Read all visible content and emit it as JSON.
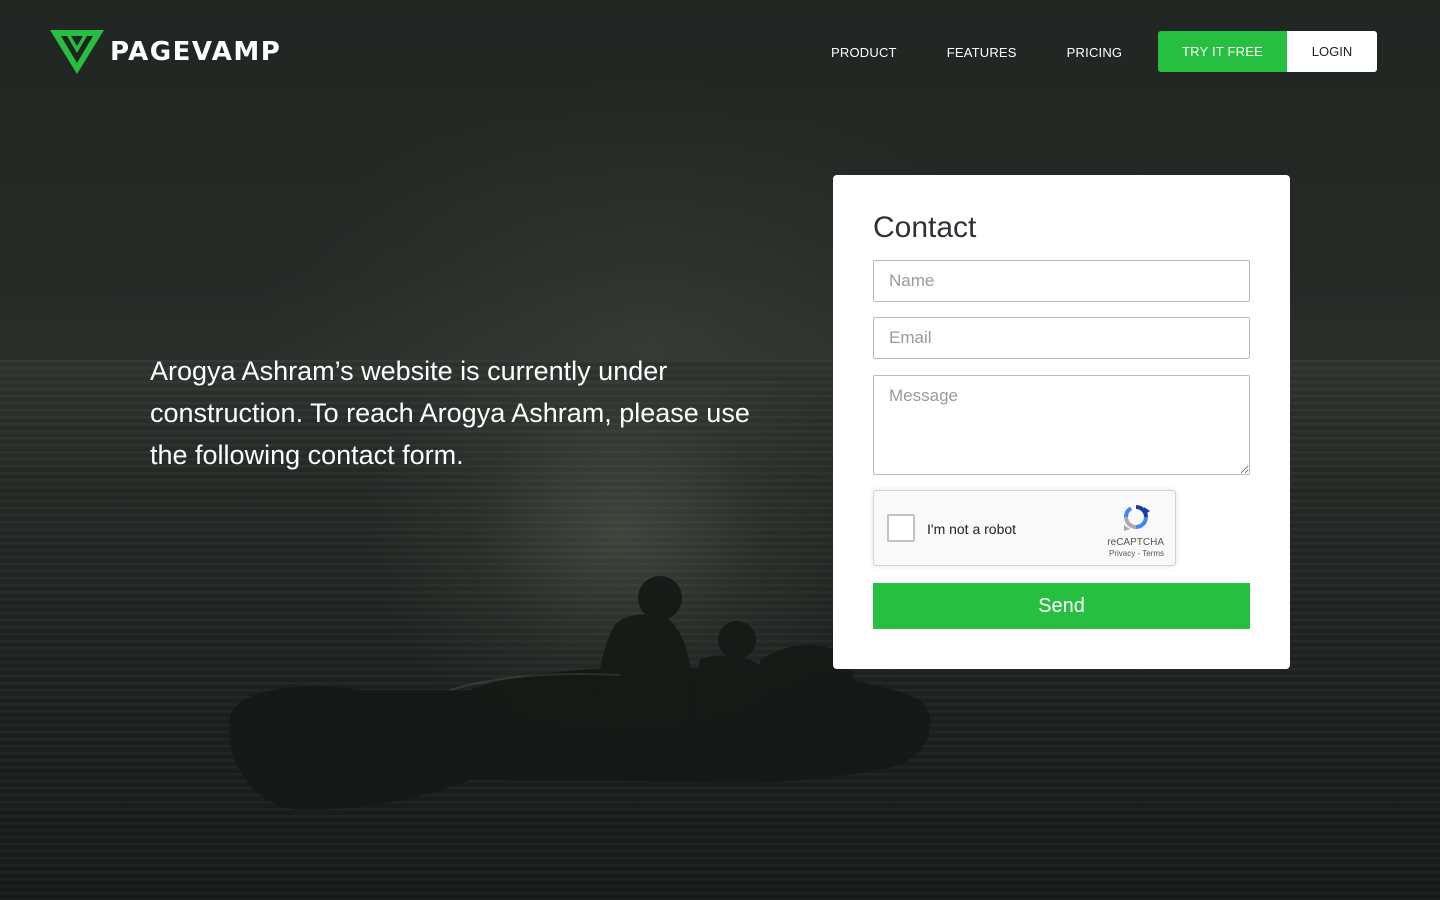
{
  "brand": {
    "name": "PAGEVAMP",
    "accent": "#26bf3f"
  },
  "nav": {
    "items": [
      "PRODUCT",
      "FEATURES",
      "PRICING"
    ],
    "try_label": "TRY IT FREE",
    "login_label": "LOGIN"
  },
  "hero": {
    "text": "Arogya Ashram’s website is currently under construction. To reach Arogya Ashram, please use the following contact form."
  },
  "contact": {
    "title": "Contact",
    "name_placeholder": "Name",
    "email_placeholder": "Email",
    "message_placeholder": "Message",
    "captcha_label": "I'm not a robot",
    "captcha_brand": "reCAPTCHA",
    "captcha_links": "Privacy - Terms",
    "send_label": "Send"
  }
}
